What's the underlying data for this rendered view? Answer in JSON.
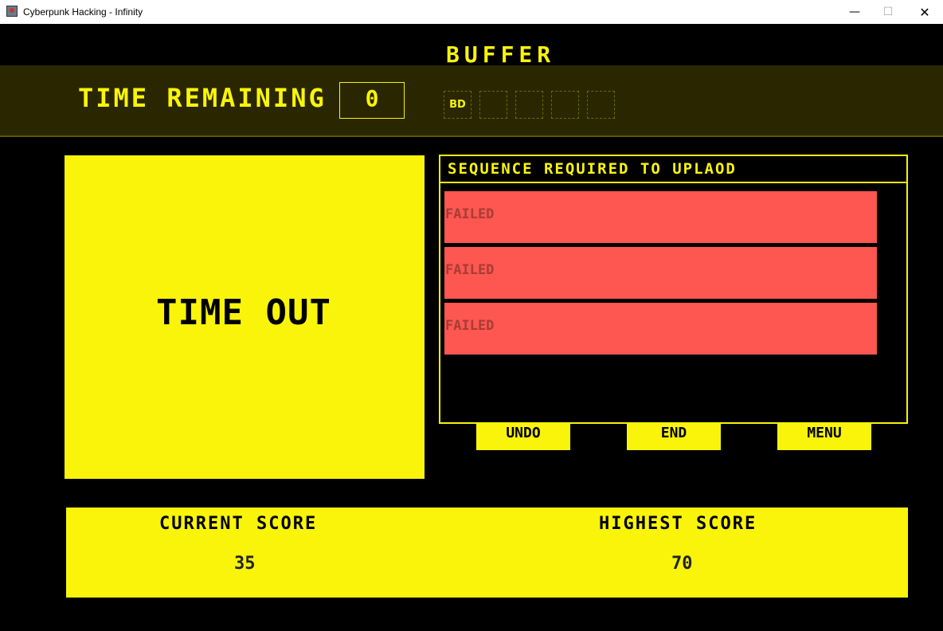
{
  "window": {
    "title": "Cyberpunk Hacking - Infinity",
    "controls": {
      "minimize": "—",
      "maximize": "☐",
      "close": "✕"
    }
  },
  "colors": {
    "accent": "#f9f409",
    "failed": "#fe5650",
    "band": "#2a2700",
    "background": "#000000"
  },
  "buffer": {
    "title": "BUFFER",
    "slots": [
      "BD",
      "",
      "",
      "",
      "",
      ""
    ]
  },
  "timer": {
    "label": "TIME REMAINING",
    "value": "0"
  },
  "game": {
    "status": "TIME OUT"
  },
  "sequences": {
    "header": "SEQUENCE REQUIRED TO UPLAOD",
    "items": [
      {
        "status": "FAILED"
      },
      {
        "status": "FAILED"
      },
      {
        "status": "FAILED"
      }
    ]
  },
  "buttons": {
    "undo": "UNDO",
    "end": "END",
    "menu": "MENU"
  },
  "scores": {
    "current_label": "CURRENT SCORE",
    "current_value": "35",
    "highest_label": "HIGHEST SCORE",
    "highest_value": "70"
  }
}
